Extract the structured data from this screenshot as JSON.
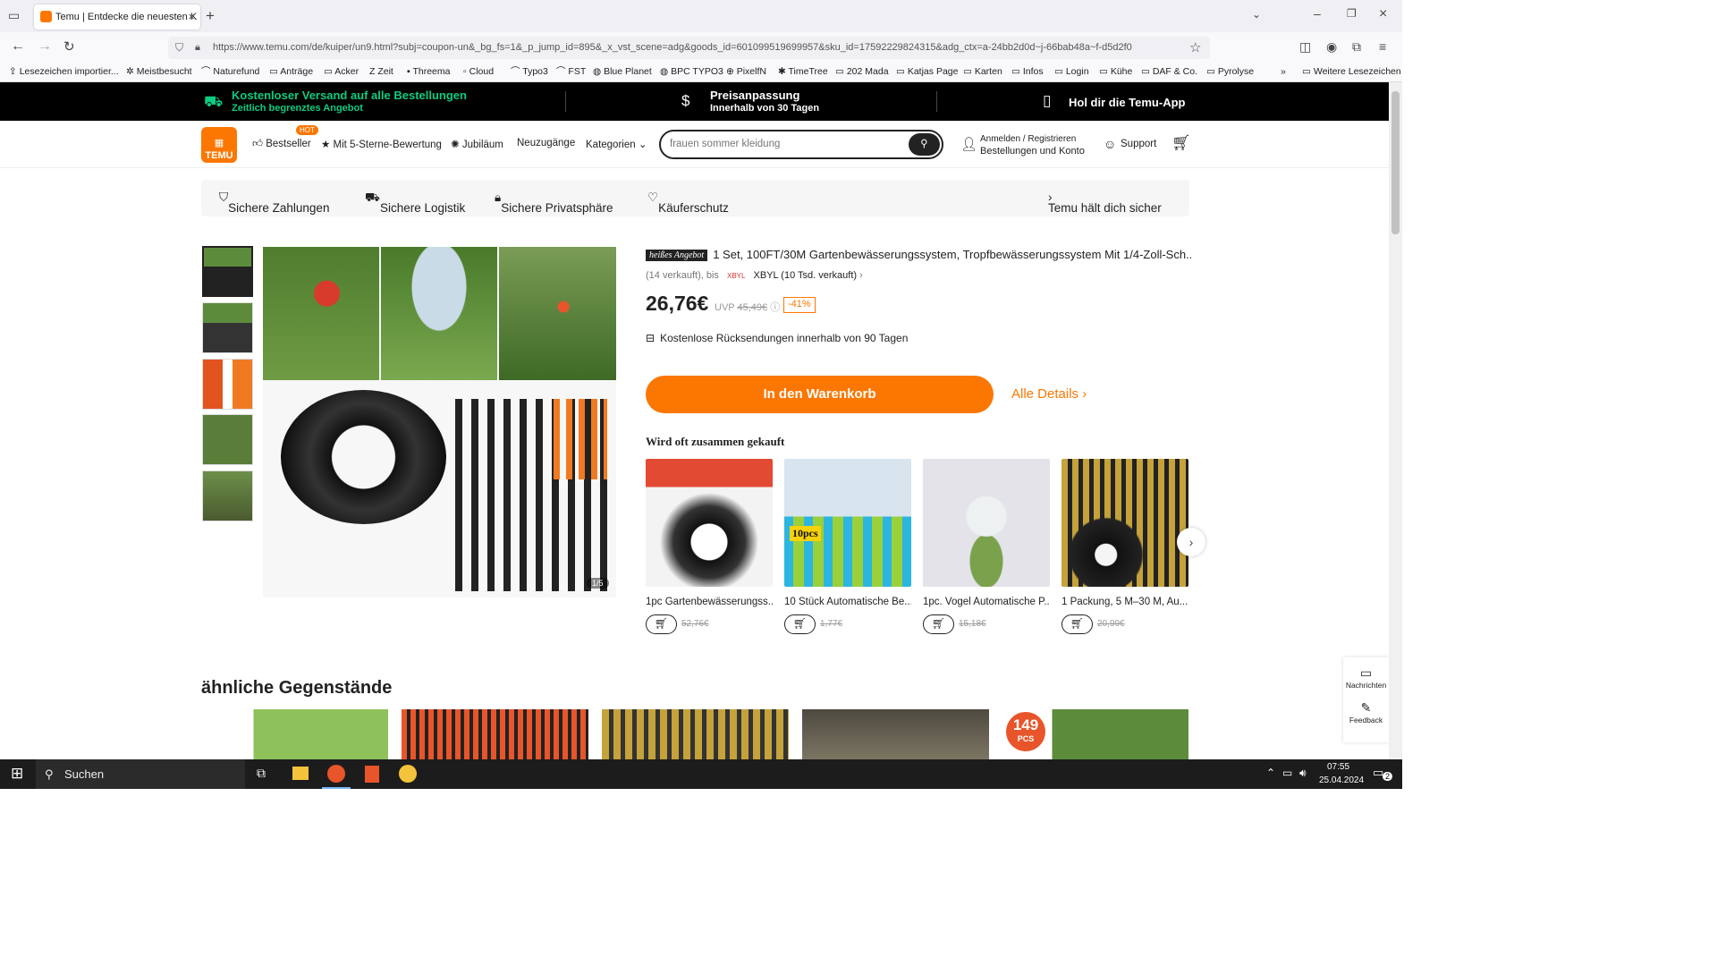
{
  "browser": {
    "tab_title": "Temu | Entdecke die neuesten K",
    "url": "https://www.temu.com/de/kuiper/un9.html?subj=coupon-un&_bg_fs=1&_p_jump_id=895&_x_vst_scene=adg&goods_id=601099519699957&sku_id=17592229824315&adg_ctx=a-24bb2d0d~j-66bab48a~f-d5d2f0",
    "bookmarks": [
      "Lesezeichen importier...",
      "Meistbesucht",
      "Naturefund",
      "Anträge",
      "Acker",
      "Zeit",
      "Threema",
      "Cloud",
      "Typo3",
      "FST",
      "Blue Planet",
      "BPC TYPO3",
      "PixelfN",
      "TimeTree",
      "202 Mada",
      "Katjas Page",
      "Karten",
      "Infos",
      "Login",
      "Kühe",
      "DAF & Co.",
      "Pyrolyse"
    ],
    "more_bookmarks": "Weitere Lesezeichen"
  },
  "banner": {
    "shipping_title": "Kostenloser Versand auf alle Bestellungen",
    "shipping_sub": "Zeitlich begrenztes Angebot",
    "price_title": "Preisanpassung",
    "price_sub": "Innerhalb von 30 Tagen",
    "app": "Hol dir die Temu-App"
  },
  "nav": {
    "logo": "TEMU",
    "hot_badge": "HOT",
    "bestseller": "Bestseller",
    "five_star": "Mit 5-Sterne-Bewertung",
    "jubilee": "Jubiläum",
    "new": "Neuzugänge",
    "categories": "Kategorien",
    "search_placeholder": "frauen sommer kleidung",
    "signin": "Anmelden / Registrieren",
    "orders": "Bestellungen und Konto",
    "support": "Support"
  },
  "trust": {
    "payments": "Sichere Zahlungen",
    "logistics": "Sichere Logistik",
    "privacy": "Sichere Privatsphäre",
    "protection": "Käuferschutz",
    "safe": "Temu hält dich sicher"
  },
  "product": {
    "hot_label": "heißes Angebot",
    "title": "1 Set, 100FT/30M Gartenbewässerungssystem, Tropfbewässerungssystem Mit 1/4-Zoll-Sch...",
    "sold": "(14 verkauft), bis",
    "seller": "XBYL (10 Tsd. verkauft)",
    "price": "26,76€",
    "uvp_label": "UVP",
    "uvp": "45,49€",
    "discount": "-41%",
    "returns": "Kostenlose Rücksendungen innerhalb von 90 Tagen",
    "cart_button": "In den Warenkorb",
    "details": "Alle Details",
    "image_counter": "1/5"
  },
  "frequently": {
    "title": "Wird oft zusammen gekauft",
    "items": [
      {
        "name": "1pc Gartenbewässerungss...",
        "old_price": "52,76€"
      },
      {
        "name": "10 Stück Automatische Be...",
        "old_price": "1,77€",
        "badge": "10pcs"
      },
      {
        "name": "1pc. Vogel Automatische P...",
        "old_price": "15,18€"
      },
      {
        "name": "1 Packung, 5 M–30 M, Au...",
        "old_price": "20,99€"
      }
    ]
  },
  "similar": {
    "title": "ähnliche Gegenstände",
    "badge": "149",
    "badge_sub": "PCS"
  },
  "side": {
    "messages": "Nachrichten",
    "feedback": "Feedback"
  },
  "taskbar": {
    "search": "Suchen",
    "time": "07:55",
    "date": "25.04.2024",
    "notifications": "2"
  }
}
